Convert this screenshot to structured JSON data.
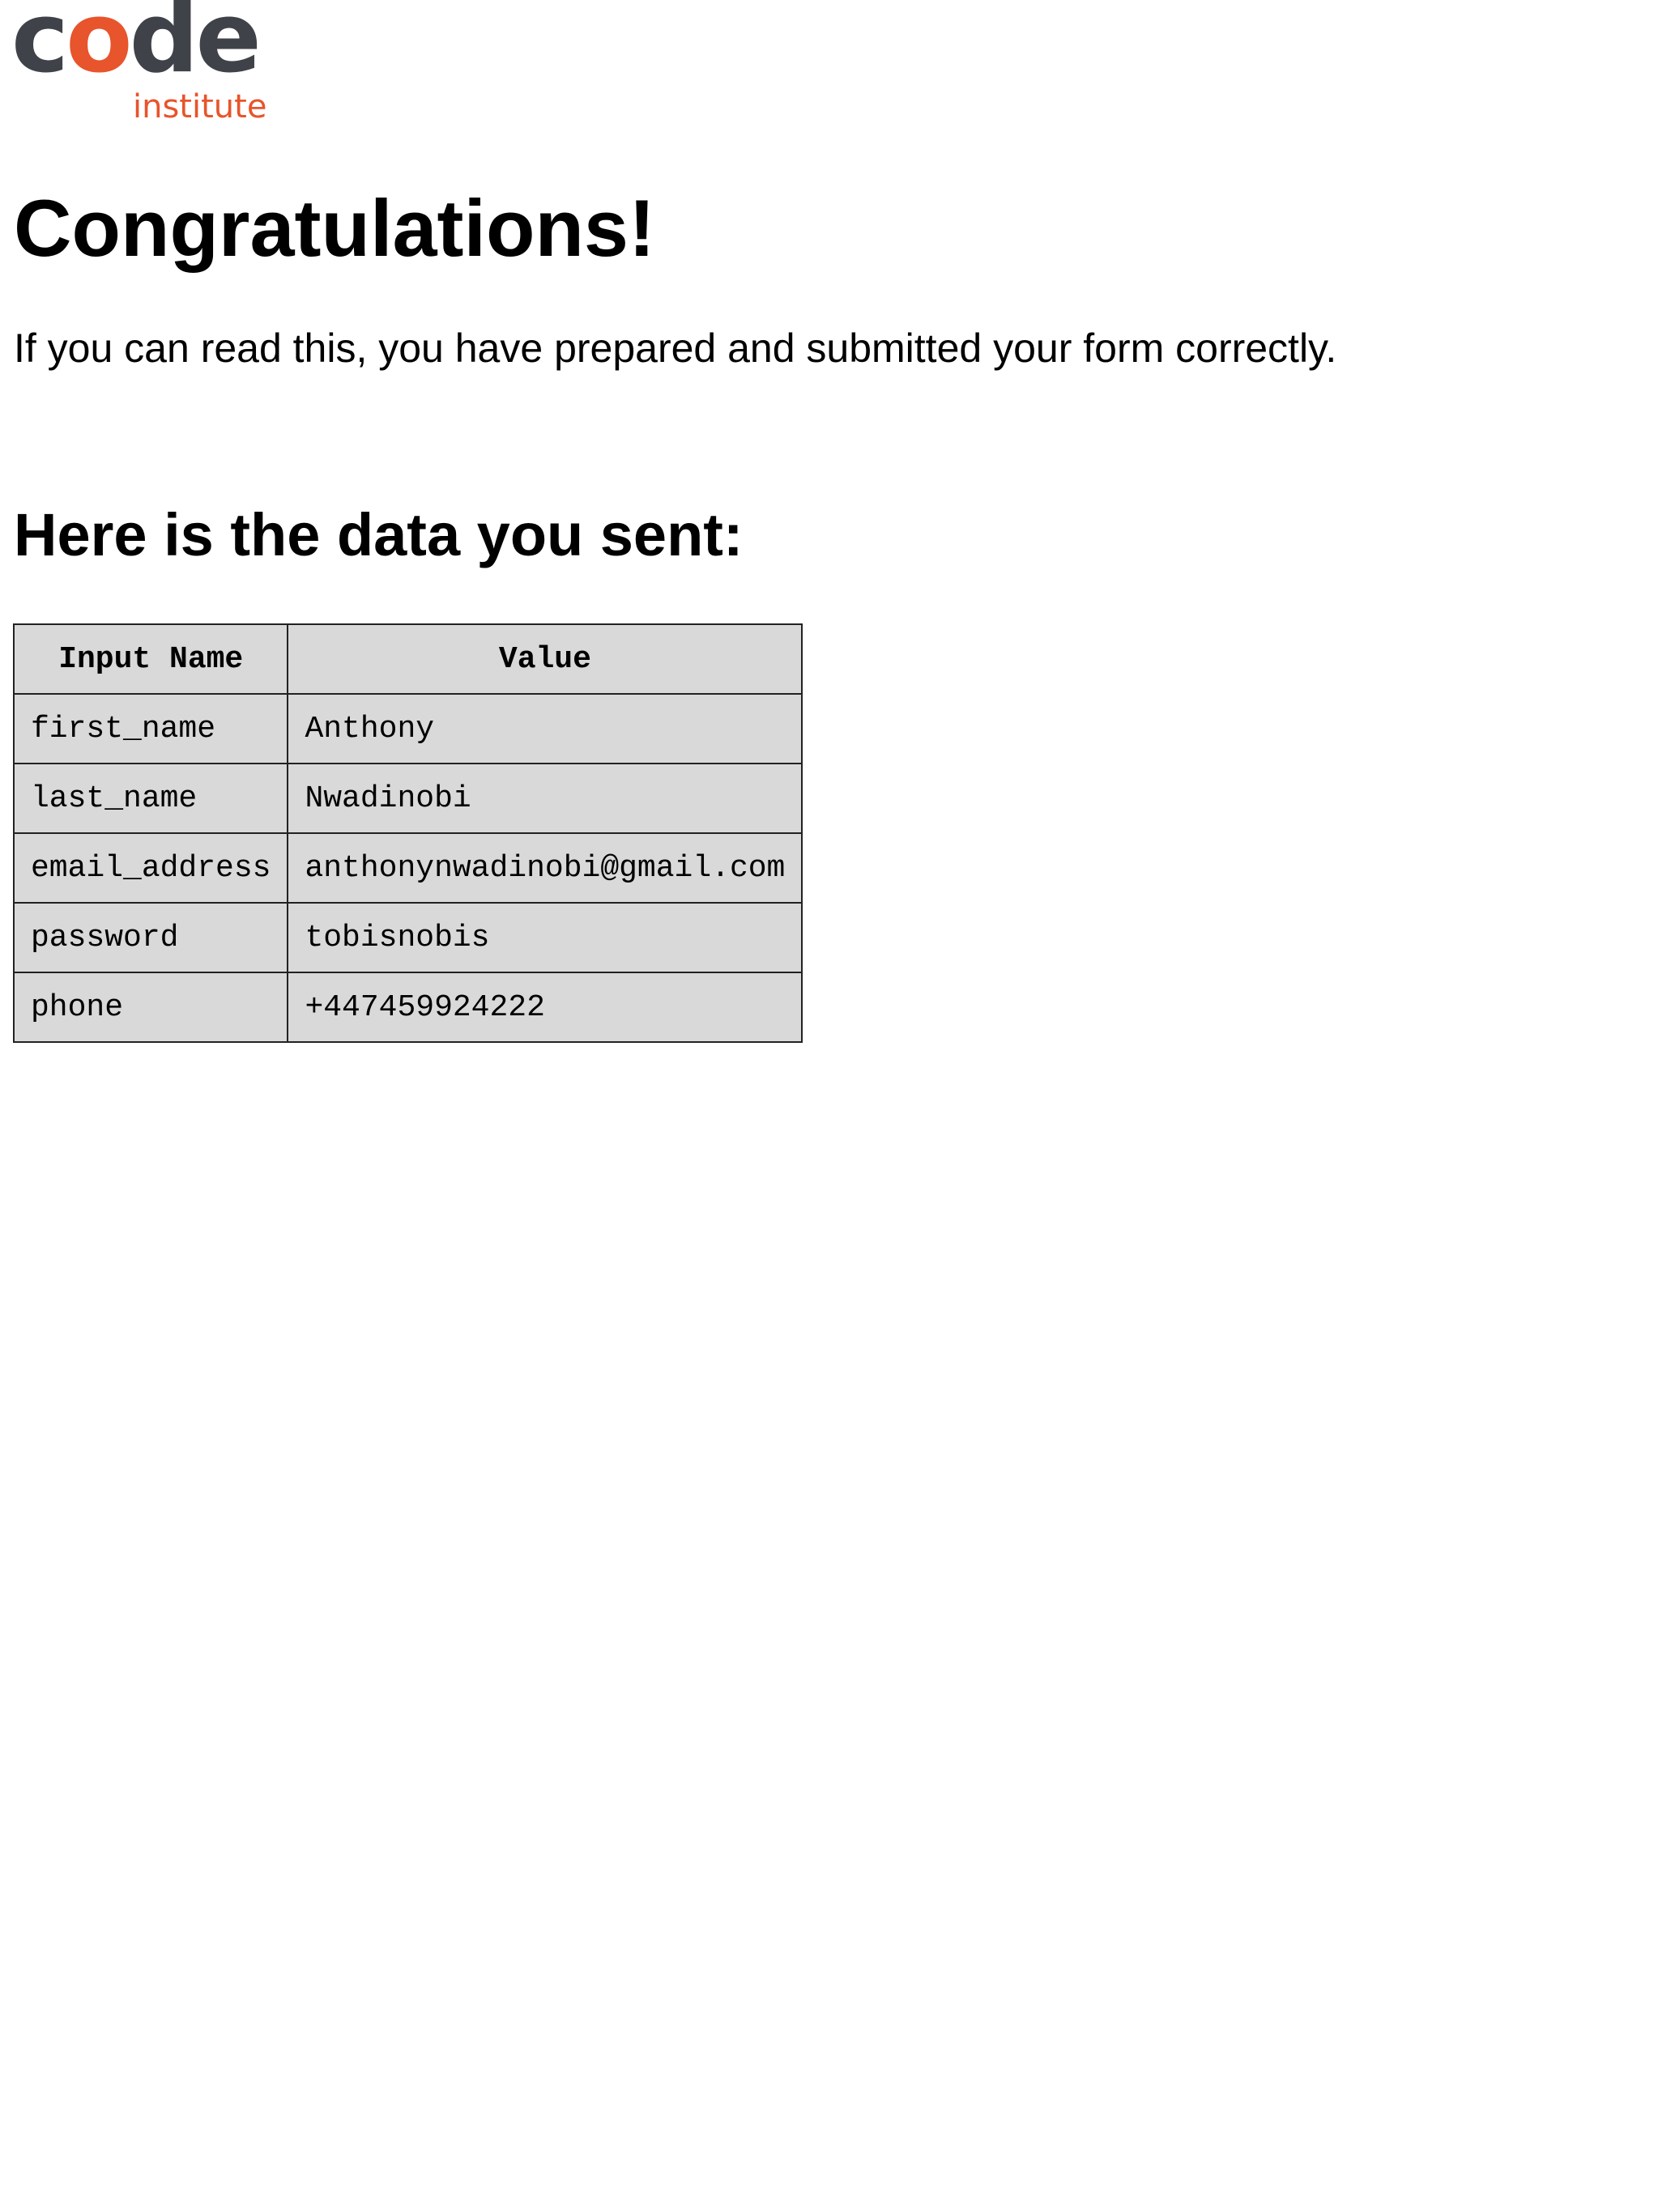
{
  "logo": {
    "word_prefix": "c",
    "word_o": "o",
    "word_suffix": "de",
    "subtitle": "institute",
    "colors": {
      "dark": "#3f4249",
      "accent": "#e8542b"
    }
  },
  "page": {
    "title": "Congratulations!",
    "intro": "If you can read this, you have prepared and submitted your form correctly.",
    "subtitle": "Here is the data you sent:"
  },
  "table": {
    "headers": [
      "Input Name",
      "Value"
    ],
    "rows": [
      [
        "first_name",
        "Anthony"
      ],
      [
        "last_name",
        "Nwadinobi"
      ],
      [
        "email_address",
        "anthonynwadinobi@gmail.com"
      ],
      [
        "password",
        "tobisnobis"
      ],
      [
        "phone",
        "+447459924222"
      ]
    ],
    "background": "#d9d9d9"
  }
}
